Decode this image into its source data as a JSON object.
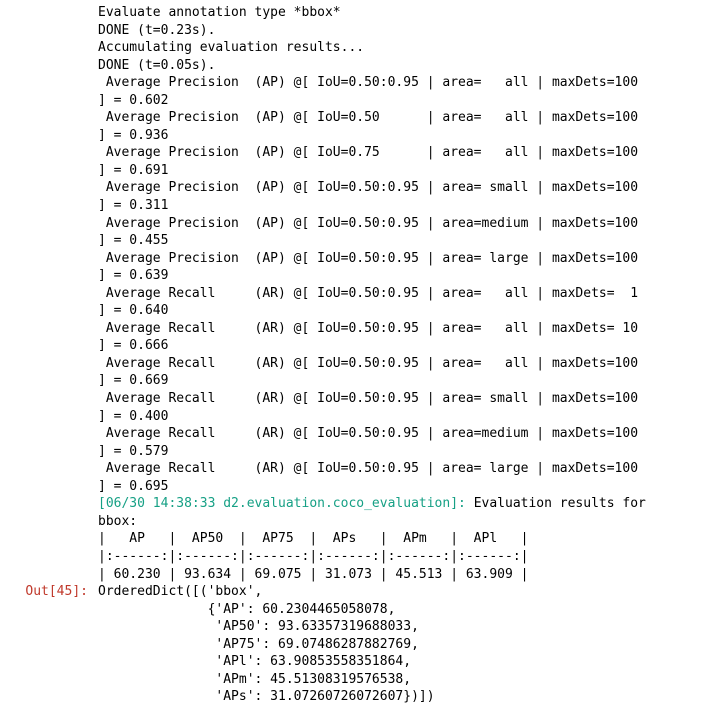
{
  "stream": {
    "lines": [
      {
        "cls": "",
        "text": "Evaluate annotation type *bbox*"
      },
      {
        "cls": "",
        "text": "DONE (t=0.23s)."
      },
      {
        "cls": "",
        "text": "Accumulating evaluation results..."
      },
      {
        "cls": "",
        "text": "DONE (t=0.05s)."
      },
      {
        "cls": "",
        "text": " Average Precision  (AP) @[ IoU=0.50:0.95 | area=   all | maxDets=100"
      },
      {
        "cls": "",
        "text": "] = 0.602"
      },
      {
        "cls": "",
        "text": " Average Precision  (AP) @[ IoU=0.50      | area=   all | maxDets=100"
      },
      {
        "cls": "",
        "text": "] = 0.936"
      },
      {
        "cls": "",
        "text": " Average Precision  (AP) @[ IoU=0.75      | area=   all | maxDets=100"
      },
      {
        "cls": "",
        "text": "] = 0.691"
      },
      {
        "cls": "",
        "text": " Average Precision  (AP) @[ IoU=0.50:0.95 | area= small | maxDets=100"
      },
      {
        "cls": "",
        "text": "] = 0.311"
      },
      {
        "cls": "",
        "text": " Average Precision  (AP) @[ IoU=0.50:0.95 | area=medium | maxDets=100"
      },
      {
        "cls": "",
        "text": "] = 0.455"
      },
      {
        "cls": "",
        "text": " Average Precision  (AP) @[ IoU=0.50:0.95 | area= large | maxDets=100"
      },
      {
        "cls": "",
        "text": "] = 0.639"
      },
      {
        "cls": "",
        "text": " Average Recall     (AR) @[ IoU=0.50:0.95 | area=   all | maxDets=  1"
      },
      {
        "cls": "",
        "text": "] = 0.640"
      },
      {
        "cls": "",
        "text": " Average Recall     (AR) @[ IoU=0.50:0.95 | area=   all | maxDets= 10"
      },
      {
        "cls": "",
        "text": "] = 0.666"
      },
      {
        "cls": "",
        "text": " Average Recall     (AR) @[ IoU=0.50:0.95 | area=   all | maxDets=100"
      },
      {
        "cls": "",
        "text": "] = 0.669"
      },
      {
        "cls": "",
        "text": " Average Recall     (AR) @[ IoU=0.50:0.95 | area= small | maxDets=100"
      },
      {
        "cls": "",
        "text": "] = 0.400"
      },
      {
        "cls": "",
        "text": " Average Recall     (AR) @[ IoU=0.50:0.95 | area=medium | maxDets=100"
      },
      {
        "cls": "",
        "text": "] = 0.579"
      },
      {
        "cls": "",
        "text": " Average Recall     (AR) @[ IoU=0.50:0.95 | area= large | maxDets=100"
      },
      {
        "cls": "",
        "text": "] = 0.695"
      }
    ],
    "logger_prefix": "[06/30 14:38:33 d2.evaluation.coco_evaluation]: ",
    "logger_suffix": "Evaluation results for",
    "after_logger": [
      "bbox:",
      "|   AP   |  AP50  |  AP75  |  APs   |  APm   |  APl   |",
      "|:------:|:------:|:------:|:------:|:------:|:------:|",
      "| 60.230 | 93.634 | 69.075 | 31.073 | 45.513 | 63.909 |"
    ]
  },
  "out": {
    "prompt": "Out[45]:",
    "lines": [
      "OrderedDict([('bbox',",
      "              {'AP': 60.2304465058078,",
      "               'AP50': 93.63357319688033,",
      "               'AP75': 69.07486287882769,",
      "               'APl': 63.90853558351864,",
      "               'APm': 45.51308319576538,",
      "               'APs': 31.07260726072607})])"
    ]
  },
  "chart_data": {
    "type": "table",
    "title": "COCO evaluation — Average Precision / Recall (bbox)",
    "AP": {
      "IoU=0.50:0.95 | area=all   | maxDets=100": 0.602,
      "IoU=0.50      | area=all   | maxDets=100": 0.936,
      "IoU=0.75      | area=all   | maxDets=100": 0.691,
      "IoU=0.50:0.95 | area=small | maxDets=100": 0.311,
      "IoU=0.50:0.95 | area=medium| maxDets=100": 0.455,
      "IoU=0.50:0.95 | area=large | maxDets=100": 0.639
    },
    "AR": {
      "IoU=0.50:0.95 | area=all   | maxDets=1": 0.64,
      "IoU=0.50:0.95 | area=all   | maxDets=10": 0.666,
      "IoU=0.50:0.95 | area=all   | maxDets=100": 0.669,
      "IoU=0.50:0.95 | area=small | maxDets=100": 0.4,
      "IoU=0.50:0.95 | area=medium| maxDets=100": 0.579,
      "IoU=0.50:0.95 | area=large | maxDets=100": 0.695
    },
    "summary_table": {
      "headers": [
        "AP",
        "AP50",
        "AP75",
        "APs",
        "APm",
        "APl"
      ],
      "values": [
        60.23,
        93.634,
        69.075,
        31.073,
        45.513,
        63.909
      ]
    },
    "ordered_dict_bbox": {
      "AP": 60.2304465058078,
      "AP50": 93.63357319688033,
      "AP75": 69.07486287882769,
      "APl": 63.90853558351864,
      "APm": 45.51308319576538,
      "APs": 31.07260726072607
    }
  }
}
